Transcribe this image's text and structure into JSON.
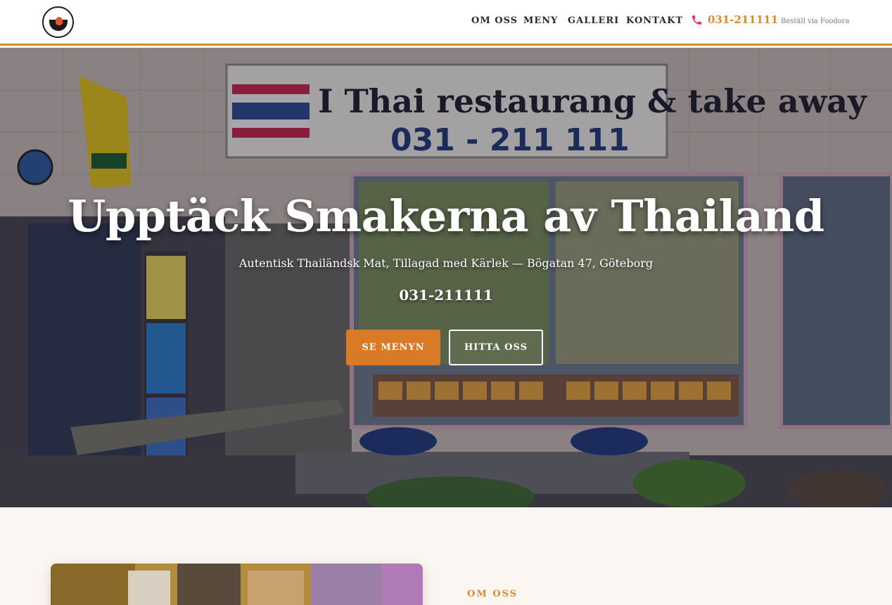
{
  "header": {
    "logo_alt": "I Thai restaurang & take away",
    "nav": {
      "om_oss": "OM OSS",
      "meny": "MENY",
      "galleri": "GALLERI",
      "kontakt": "KONTAKT"
    },
    "phone": "031-211111",
    "foodora": "Beställ via Foodora"
  },
  "hero": {
    "title": "Upptäck Smakerna av Thailand",
    "subtitle": "Autentisk Thailändsk Mat, Tillagad med Kärlek — Bögatan 47, Göteborg",
    "phone": "031-211111",
    "primary_button": "SE MENYN",
    "secondary_button": "HITTA OSS",
    "sign_text": "I Thai restaurang & take away",
    "sign_phone": "031 - 211 111"
  },
  "about": {
    "label": "OM OSS"
  },
  "colors": {
    "accent": "#d98a2b",
    "button": "#d97a26"
  },
  "icons": {
    "phone": "phone-icon"
  }
}
